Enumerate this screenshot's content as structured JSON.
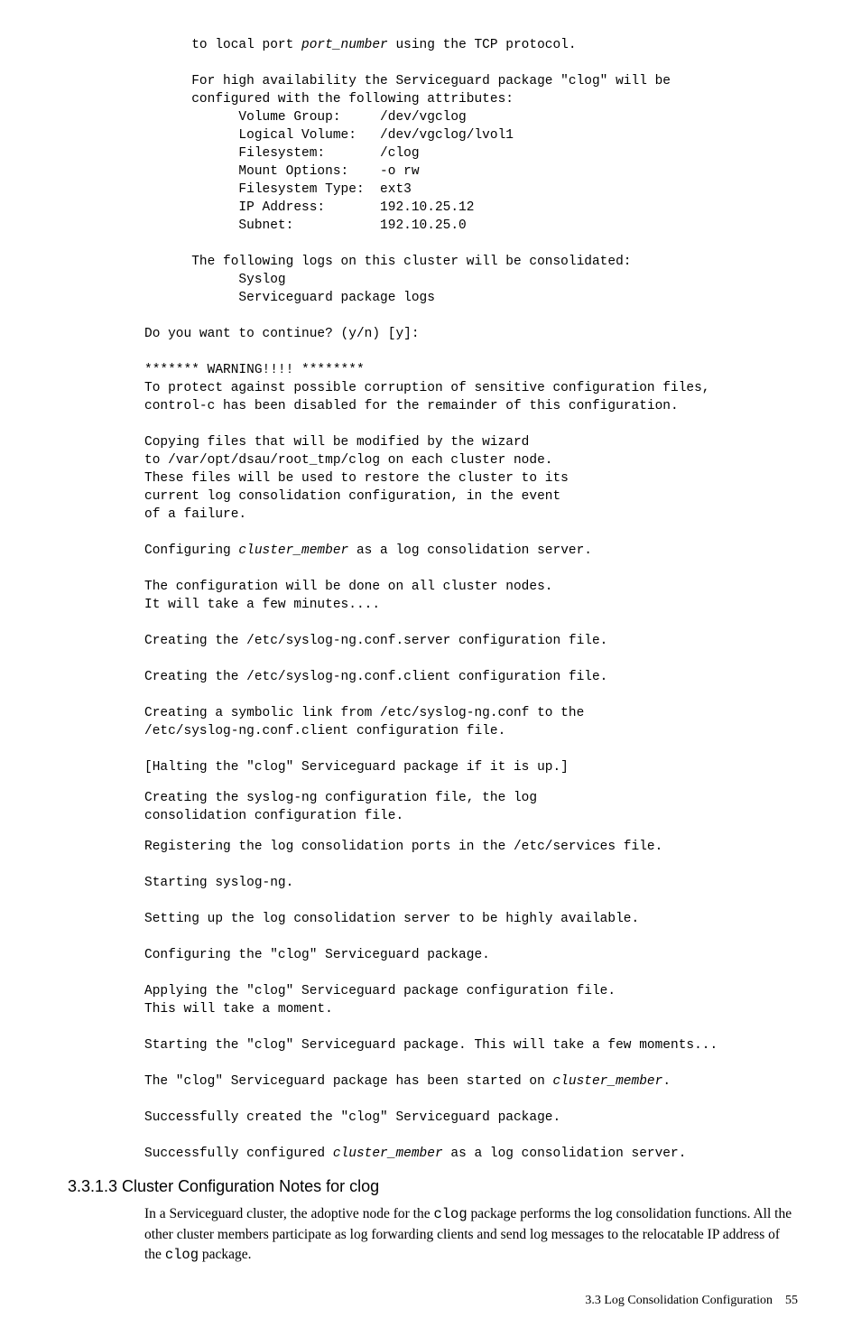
{
  "block1_a": "      to local port ",
  "block1_b": "port_number",
  "block1_c": " using the TCP protocol.\n\n      For high availability the Serviceguard package \"clog\" will be\n      configured with the following attributes:\n            Volume Group:     /dev/vgclog\n            Logical Volume:   /dev/vgclog/lvol1\n            Filesystem:       /clog\n            Mount Options:    -o rw\n            Filesystem Type:  ext3\n            IP Address:       192.10.25.12\n            Subnet:           192.10.25.0\n\n      The following logs on this cluster will be consolidated:\n            Syslog\n            Serviceguard package logs\n\nDo you want to continue? (y/n) [y]:\n\n******* WARNING!!!! ********\nTo protect against possible corruption of sensitive configuration files,\ncontrol-c has been disabled for the remainder of this configuration.\n\nCopying files that will be modified by the wizard\nto /var/opt/dsau/root_tmp/clog on each cluster node.\nThese files will be used to restore the cluster to its\ncurrent log consolidation configuration, in the event\nof a failure.\n\nConfiguring ",
  "block1_d": "cluster_member",
  "block1_e": " as a log consolidation server.\n\nThe configuration will be done on all cluster nodes.\nIt will take a few minutes....\n\nCreating the /etc/syslog-ng.conf.server configuration file.\n\nCreating the /etc/syslog-ng.conf.client configuration file.\n\nCreating a symbolic link from /etc/syslog-ng.conf to the\n/etc/syslog-ng.conf.client configuration file.\n\n[Halting the \"clog\" Serviceguard package if it is up.]",
  "block2": "Creating the syslog-ng configuration file, the log\nconsolidation configuration file.",
  "block3_a": "Registering the log consolidation ports in the /etc/services file.\n\nStarting syslog-ng.\n\nSetting up the log consolidation server to be highly available.\n\nConfiguring the \"clog\" Serviceguard package.\n\nApplying the \"clog\" Serviceguard package configuration file.\nThis will take a moment.\n\nStarting the \"clog\" Serviceguard package. This will take a few moments...\n\nThe \"clog\" Serviceguard package has been started on ",
  "block3_b": "cluster_member",
  "block3_c": ".\n\nSuccessfully created the \"clog\" Serviceguard package.\n\nSuccessfully configured ",
  "block3_d": "cluster_member",
  "block3_e": " as a log consolidation server.",
  "heading": "3.3.1.3 Cluster Configuration Notes for clog",
  "para_a": "In a Serviceguard cluster, the adoptive node for the ",
  "para_b": "clog",
  "para_c": " package performs the log consolidation functions. All the other cluster members participate as log forwarding clients and send log messages to the relocatable IP address of the ",
  "para_d": "clog",
  "para_e": " package.",
  "footer_label": "3.3 Log Consolidation Configuration",
  "footer_page": "55"
}
